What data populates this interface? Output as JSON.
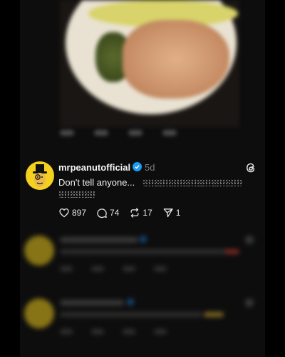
{
  "post": {
    "username": "mrpeanutofficial",
    "time": "5d",
    "caption": "Don't tell anyone...",
    "likes": "897",
    "comments": "74",
    "reposts": "17",
    "shares": "1"
  },
  "colors": {
    "background": "#0d0d0e",
    "avatar": "#f6d01f",
    "verified": "#1d9bf0",
    "text": "#f3f3f3",
    "muted": "#7b7b7b"
  },
  "icons": {
    "verified": "verified-badge-icon",
    "threads": "threads-logo-icon",
    "like": "heart-icon",
    "comment": "comment-bubble-icon",
    "repost": "repost-icon",
    "share": "send-icon"
  }
}
